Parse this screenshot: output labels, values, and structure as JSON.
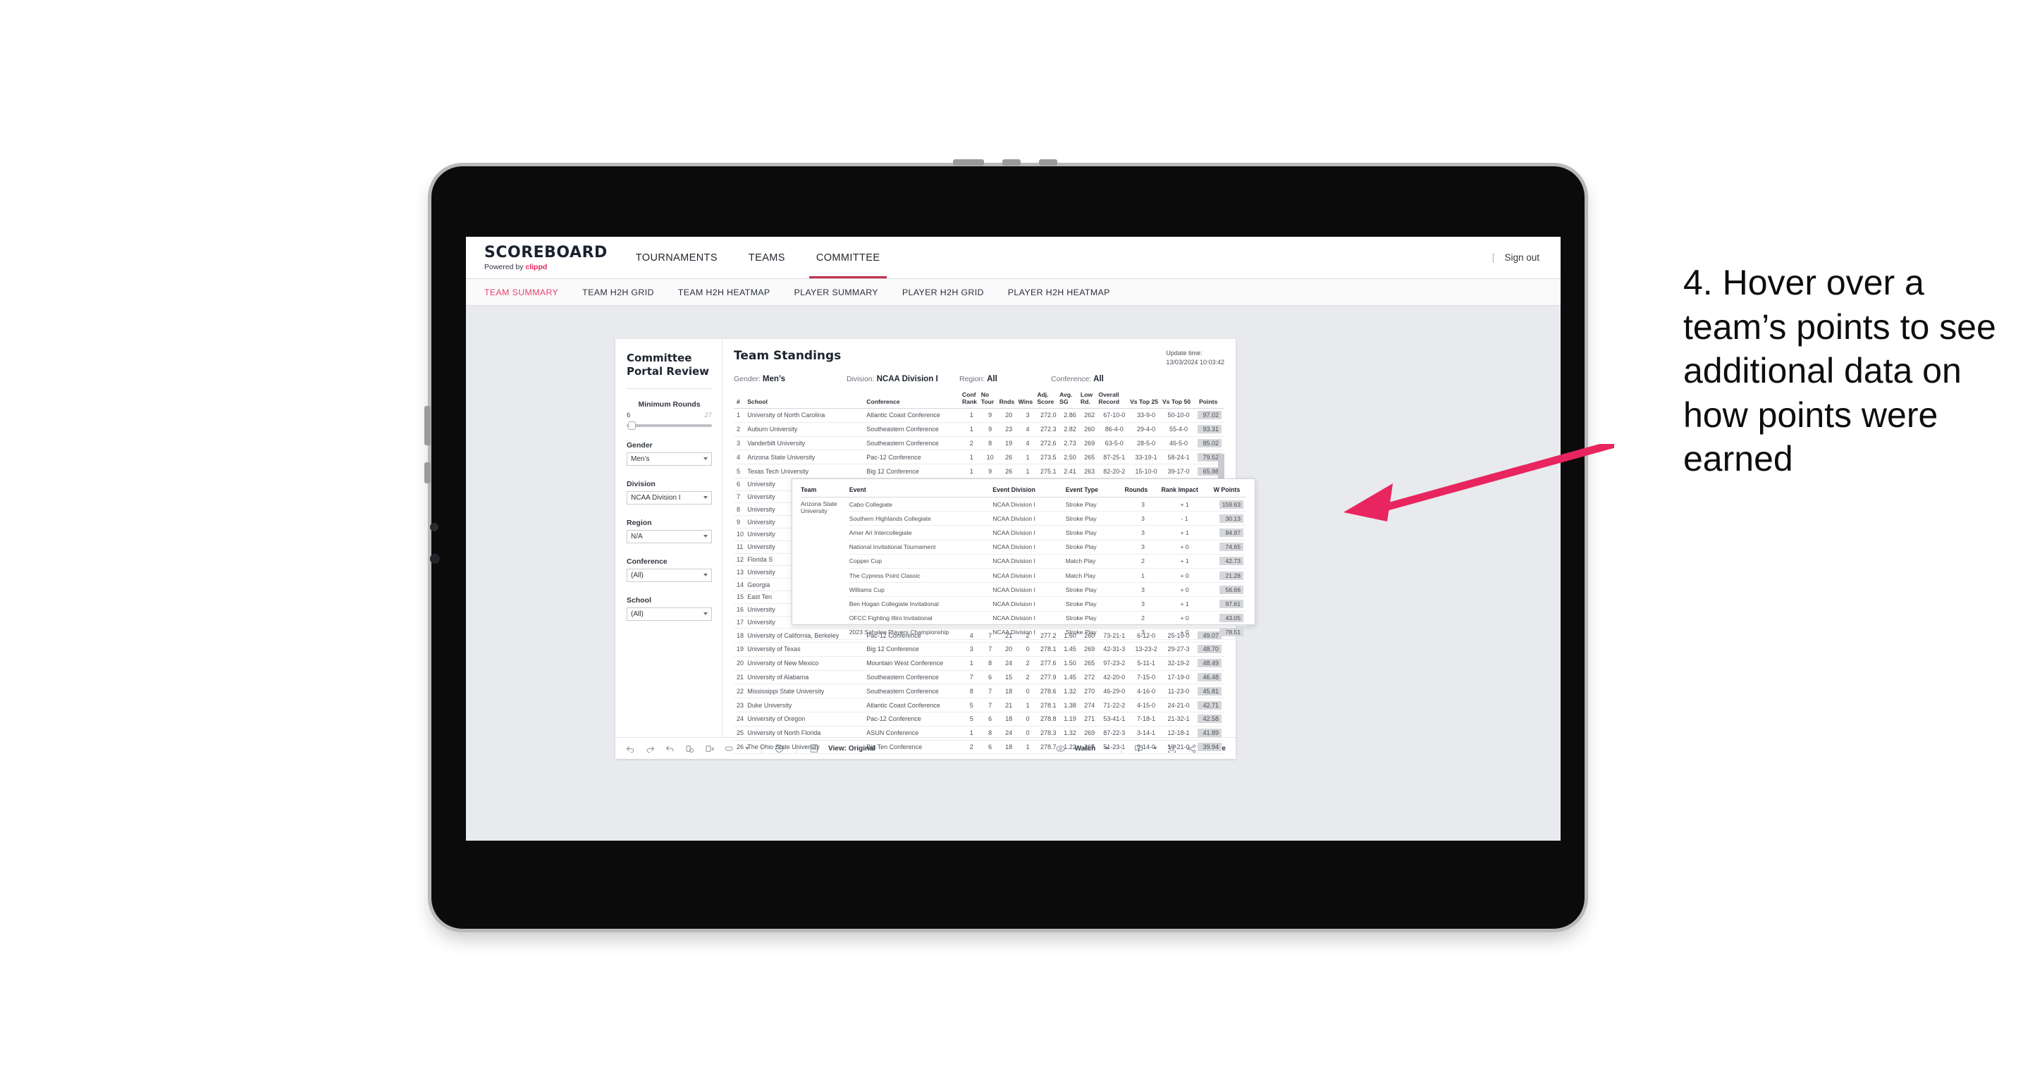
{
  "brand": {
    "title": "SCOREBOARD",
    "powered_prefix": "Powered by ",
    "powered_name": "clippd"
  },
  "topnav": {
    "items": [
      {
        "label": "TOURNAMENTS",
        "active": false
      },
      {
        "label": "TEAMS",
        "active": false
      },
      {
        "label": "COMMITTEE",
        "active": true
      }
    ],
    "divider": "|",
    "signout": "Sign out"
  },
  "subtabs": [
    {
      "label": "TEAM SUMMARY",
      "active": true
    },
    {
      "label": "TEAM H2H GRID",
      "active": false
    },
    {
      "label": "TEAM H2H HEATMAP",
      "active": false
    },
    {
      "label": "PLAYER SUMMARY",
      "active": false
    },
    {
      "label": "PLAYER H2H GRID",
      "active": false
    },
    {
      "label": "PLAYER H2H HEATMAP",
      "active": false
    }
  ],
  "filters": {
    "panel_title": "Committee Portal Review",
    "slider": {
      "label": "Minimum Rounds",
      "min": "6",
      "max": "27",
      "value_pct": 2
    },
    "groups": [
      {
        "label": "Gender",
        "value": "Men’s"
      },
      {
        "label": "Division",
        "value": "NCAA Division I"
      },
      {
        "label": "Region",
        "value": "N/A"
      },
      {
        "label": "Conference",
        "value": "(All)"
      },
      {
        "label": "School",
        "value": "(All)"
      }
    ]
  },
  "standings": {
    "title": "Team Standings",
    "update_label": "Update time:",
    "update_value": "13/03/2024 10:03:42",
    "meta": [
      {
        "label": "Gender:",
        "value": "Men’s"
      },
      {
        "label": "Division:",
        "value": "NCAA Division I"
      },
      {
        "label": "Region:",
        "value": "All"
      },
      {
        "label": "Conference:",
        "value": "All"
      }
    ],
    "columns": [
      "#",
      "School",
      "Conference",
      "Conf Rank",
      "No Tour",
      "Rnds",
      "Wins",
      "Adj. Score",
      "Avg. SG",
      "Low Rd.",
      "Overall Record",
      "Vs Top 25",
      "Vs Top 50",
      "Points"
    ],
    "rows": [
      {
        "rank": "1",
        "school": "University of North Carolina",
        "conference": "Atlantic Coast Conference",
        "conf_rank": "1",
        "no_tour": "9",
        "rnds": "20",
        "wins": "3",
        "adj_score": "272.0",
        "avg_sg": "2.86",
        "low_rd": "262",
        "record": "67-10-0",
        "vs25": "33-9-0",
        "vs50": "50-10-0",
        "points": "97.02",
        "clipped": false
      },
      {
        "rank": "2",
        "school": "Auburn University",
        "conference": "Southeastern Conference",
        "conf_rank": "1",
        "no_tour": "9",
        "rnds": "23",
        "wins": "4",
        "adj_score": "272.3",
        "avg_sg": "2.82",
        "low_rd": "260",
        "record": "86-4-0",
        "vs25": "29-4-0",
        "vs50": "55-4-0",
        "points": "93.31",
        "clipped": false
      },
      {
        "rank": "3",
        "school": "Vanderbilt University",
        "conference": "Southeastern Conference",
        "conf_rank": "2",
        "no_tour": "8",
        "rnds": "19",
        "wins": "4",
        "adj_score": "272.6",
        "avg_sg": "2.73",
        "low_rd": "269",
        "record": "63-5-0",
        "vs25": "28-5-0",
        "vs50": "46-5-0",
        "points": "85.02",
        "clipped": false
      },
      {
        "rank": "4",
        "school": "Arizona State University",
        "conference": "Pac-12 Conference",
        "conf_rank": "1",
        "no_tour": "10",
        "rnds": "26",
        "wins": "1",
        "adj_score": "273.5",
        "avg_sg": "2.50",
        "low_rd": "265",
        "record": "87-25-1",
        "vs25": "33-19-1",
        "vs50": "58-24-1",
        "points": "79.52",
        "clipped": false
      },
      {
        "rank": "5",
        "school": "Texas Tech University",
        "conference": "Big 12 Conference",
        "conf_rank": "1",
        "no_tour": "9",
        "rnds": "26",
        "wins": "1",
        "adj_score": "275.1",
        "avg_sg": "2.41",
        "low_rd": "263",
        "record": "82-20-2",
        "vs25": "15-10-0",
        "vs50": "39-17-0",
        "points": "65.98",
        "clipped": true
      },
      {
        "rank": "6",
        "school": "University",
        "conference": "",
        "conf_rank": "",
        "no_tour": "",
        "rnds": "",
        "wins": "",
        "adj_score": "",
        "avg_sg": "",
        "low_rd": "",
        "record": "",
        "vs25": "",
        "vs50": "",
        "points": "",
        "clipped": true
      },
      {
        "rank": "7",
        "school": "University",
        "conference": "",
        "conf_rank": "",
        "no_tour": "",
        "rnds": "",
        "wins": "",
        "adj_score": "",
        "avg_sg": "",
        "low_rd": "",
        "record": "",
        "vs25": "",
        "vs50": "",
        "points": "",
        "clipped": true
      },
      {
        "rank": "8",
        "school": "University",
        "conference": "",
        "conf_rank": "",
        "no_tour": "",
        "rnds": "",
        "wins": "",
        "adj_score": "",
        "avg_sg": "",
        "low_rd": "",
        "record": "",
        "vs25": "",
        "vs50": "",
        "points": "",
        "clipped": true
      },
      {
        "rank": "9",
        "school": "University",
        "conference": "",
        "conf_rank": "",
        "no_tour": "",
        "rnds": "",
        "wins": "",
        "adj_score": "",
        "avg_sg": "",
        "low_rd": "",
        "record": "",
        "vs25": "",
        "vs50": "",
        "points": "",
        "clipped": true
      },
      {
        "rank": "10",
        "school": "University",
        "conference": "",
        "conf_rank": "",
        "no_tour": "",
        "rnds": "",
        "wins": "",
        "adj_score": "",
        "avg_sg": "",
        "low_rd": "",
        "record": "",
        "vs25": "",
        "vs50": "",
        "points": "",
        "clipped": true
      },
      {
        "rank": "11",
        "school": "University",
        "conference": "",
        "conf_rank": "",
        "no_tour": "",
        "rnds": "",
        "wins": "",
        "adj_score": "",
        "avg_sg": "",
        "low_rd": "",
        "record": "",
        "vs25": "",
        "vs50": "",
        "points": "",
        "clipped": true
      },
      {
        "rank": "12",
        "school": "Florida S",
        "conference": "",
        "conf_rank": "",
        "no_tour": "",
        "rnds": "",
        "wins": "",
        "adj_score": "",
        "avg_sg": "",
        "low_rd": "",
        "record": "",
        "vs25": "",
        "vs50": "",
        "points": "",
        "clipped": true
      },
      {
        "rank": "13",
        "school": "University",
        "conference": "",
        "conf_rank": "",
        "no_tour": "",
        "rnds": "",
        "wins": "",
        "adj_score": "",
        "avg_sg": "",
        "low_rd": "",
        "record": "",
        "vs25": "",
        "vs50": "",
        "points": "",
        "clipped": true
      },
      {
        "rank": "14",
        "school": "Georgia",
        "conference": "",
        "conf_rank": "",
        "no_tour": "",
        "rnds": "",
        "wins": "",
        "adj_score": "",
        "avg_sg": "",
        "low_rd": "",
        "record": "",
        "vs25": "",
        "vs50": "",
        "points": "",
        "clipped": true
      },
      {
        "rank": "15",
        "school": "East Ten",
        "conference": "",
        "conf_rank": "",
        "no_tour": "",
        "rnds": "",
        "wins": "",
        "adj_score": "",
        "avg_sg": "",
        "low_rd": "",
        "record": "",
        "vs25": "",
        "vs50": "",
        "points": "",
        "clipped": true
      },
      {
        "rank": "16",
        "school": "University",
        "conference": "",
        "conf_rank": "",
        "no_tour": "",
        "rnds": "",
        "wins": "",
        "adj_score": "",
        "avg_sg": "",
        "low_rd": "",
        "record": "",
        "vs25": "",
        "vs50": "",
        "points": "",
        "clipped": true
      },
      {
        "rank": "17",
        "school": "University",
        "conference": "",
        "conf_rank": "",
        "no_tour": "",
        "rnds": "",
        "wins": "",
        "adj_score": "",
        "avg_sg": "",
        "low_rd": "",
        "record": "",
        "vs25": "",
        "vs50": "",
        "points": "",
        "clipped": true
      },
      {
        "rank": "18",
        "school": "University of California, Berkeley",
        "conference": "Pac-12 Conference",
        "conf_rank": "4",
        "no_tour": "7",
        "rnds": "21",
        "wins": "2",
        "adj_score": "277.2",
        "avg_sg": "1.60",
        "low_rd": "260",
        "record": "73-21-1",
        "vs25": "6-12-0",
        "vs50": "25-19-0",
        "points": "49.07",
        "clipped": false
      },
      {
        "rank": "19",
        "school": "University of Texas",
        "conference": "Big 12 Conference",
        "conf_rank": "3",
        "no_tour": "7",
        "rnds": "20",
        "wins": "0",
        "adj_score": "278.1",
        "avg_sg": "1.45",
        "low_rd": "269",
        "record": "42-31-3",
        "vs25": "13-23-2",
        "vs50": "29-27-3",
        "points": "48.70",
        "clipped": false
      },
      {
        "rank": "20",
        "school": "University of New Mexico",
        "conference": "Mountain West Conference",
        "conf_rank": "1",
        "no_tour": "8",
        "rnds": "24",
        "wins": "2",
        "adj_score": "277.6",
        "avg_sg": "1.50",
        "low_rd": "265",
        "record": "97-23-2",
        "vs25": "5-11-1",
        "vs50": "32-19-2",
        "points": "48.49",
        "clipped": false
      },
      {
        "rank": "21",
        "school": "University of Alabama",
        "conference": "Southeastern Conference",
        "conf_rank": "7",
        "no_tour": "6",
        "rnds": "15",
        "wins": "2",
        "adj_score": "277.9",
        "avg_sg": "1.45",
        "low_rd": "272",
        "record": "42-20-0",
        "vs25": "7-15-0",
        "vs50": "17-19-0",
        "points": "46.48",
        "clipped": false
      },
      {
        "rank": "22",
        "school": "Mississippi State University",
        "conference": "Southeastern Conference",
        "conf_rank": "8",
        "no_tour": "7",
        "rnds": "18",
        "wins": "0",
        "adj_score": "278.6",
        "avg_sg": "1.32",
        "low_rd": "270",
        "record": "46-29-0",
        "vs25": "4-16-0",
        "vs50": "11-23-0",
        "points": "45.81",
        "clipped": false
      },
      {
        "rank": "23",
        "school": "Duke University",
        "conference": "Atlantic Coast Conference",
        "conf_rank": "5",
        "no_tour": "7",
        "rnds": "21",
        "wins": "1",
        "adj_score": "278.1",
        "avg_sg": "1.38",
        "low_rd": "274",
        "record": "71-22-2",
        "vs25": "4-15-0",
        "vs50": "24-21-0",
        "points": "42.71",
        "clipped": false
      },
      {
        "rank": "24",
        "school": "University of Oregon",
        "conference": "Pac-12 Conference",
        "conf_rank": "5",
        "no_tour": "6",
        "rnds": "18",
        "wins": "0",
        "adj_score": "278.8",
        "avg_sg": "1.19",
        "low_rd": "271",
        "record": "53-41-1",
        "vs25": "7-18-1",
        "vs50": "21-32-1",
        "points": "42.58",
        "clipped": false
      },
      {
        "rank": "25",
        "school": "University of North Florida",
        "conference": "ASUN Conference",
        "conf_rank": "1",
        "no_tour": "8",
        "rnds": "24",
        "wins": "0",
        "adj_score": "278.3",
        "avg_sg": "1.32",
        "low_rd": "269",
        "record": "87-22-3",
        "vs25": "3-14-1",
        "vs50": "12-18-1",
        "points": "41.89",
        "clipped": false
      },
      {
        "rank": "26",
        "school": "The Ohio State University",
        "conference": "Big Ten Conference",
        "conf_rank": "2",
        "no_tour": "6",
        "rnds": "18",
        "wins": "1",
        "adj_score": "278.7",
        "avg_sg": "1.22",
        "low_rd": "267",
        "record": "51-23-1",
        "vs25": "9-14-0",
        "vs50": "19-21-0",
        "points": "39.94",
        "clipped": false
      }
    ]
  },
  "tooltip": {
    "columns": [
      "Team",
      "Event",
      "Event Division",
      "Event Type",
      "Rounds",
      "Rank Impact",
      "W Points"
    ],
    "team": "Arizona State University",
    "rows": [
      {
        "event": "Cabo Collegiate",
        "division": "NCAA Division I",
        "type": "Stroke Play",
        "rounds": "3",
        "impact": "+ 1",
        "points": "159.63"
      },
      {
        "event": "Southern Highlands Collegiate",
        "division": "NCAA Division I",
        "type": "Stroke Play",
        "rounds": "3",
        "impact": "- 1",
        "points": "30.13"
      },
      {
        "event": "Amer Ari Intercollegiate",
        "division": "NCAA Division I",
        "type": "Stroke Play",
        "rounds": "3",
        "impact": "+ 1",
        "points": "84.97"
      },
      {
        "event": "National Invitational Tournament",
        "division": "NCAA Division I",
        "type": "Stroke Play",
        "rounds": "3",
        "impact": "+ 0",
        "points": "74.65"
      },
      {
        "event": "Copper Cup",
        "division": "NCAA Division I",
        "type": "Match Play",
        "rounds": "2",
        "impact": "+ 1",
        "points": "42.73"
      },
      {
        "event": "The Cypress Point Classic",
        "division": "NCAA Division I",
        "type": "Match Play",
        "rounds": "1",
        "impact": "+ 0",
        "points": "21.28"
      },
      {
        "event": "Williams Cup",
        "division": "NCAA Division I",
        "type": "Stroke Play",
        "rounds": "3",
        "impact": "+ 0",
        "points": "56.66"
      },
      {
        "event": "Ben Hogan Collegiate Invitational",
        "division": "NCAA Division I",
        "type": "Stroke Play",
        "rounds": "3",
        "impact": "+ 1",
        "points": "97.61"
      },
      {
        "event": "OFCC Fighting Illini Invitational",
        "division": "NCAA Division I",
        "type": "Stroke Play",
        "rounds": "2",
        "impact": "+ 0",
        "points": "43.05"
      },
      {
        "event": "2023 Sahalee Players Championship",
        "division": "NCAA Division I",
        "type": "Stroke Play",
        "rounds": "3",
        "impact": "+ 0",
        "points": "78.51"
      }
    ]
  },
  "toolbar": {
    "view_label": "View: Original",
    "watch_label": "Watch",
    "share_label": "Share"
  },
  "annotation": {
    "text": "4. Hover over a team’s points to see additional data on how points were earned"
  },
  "colors": {
    "accent_pink": "#e8265b",
    "tab_active": "#e8416e",
    "nav_underline": "#c0304f",
    "arrow": "#e8255f",
    "canvas_bg": "#e8eaed",
    "points_cell": "#d6d7da"
  }
}
